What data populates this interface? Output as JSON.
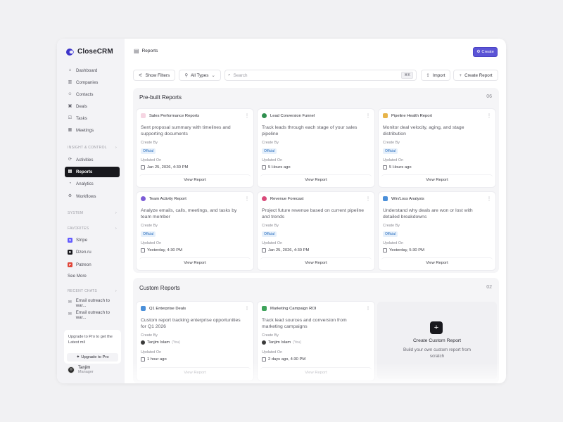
{
  "app": {
    "name": "CloseCRM"
  },
  "sidebar": {
    "main_items": [
      {
        "label": "Dashboard",
        "icon": "home-icon"
      },
      {
        "label": "Companies",
        "icon": "building-icon"
      },
      {
        "label": "Contacts",
        "icon": "users-icon"
      },
      {
        "label": "Deals",
        "icon": "briefcase-icon"
      },
      {
        "label": "Tasks",
        "icon": "checklist-icon"
      },
      {
        "label": "Meetings",
        "icon": "calendar-icon"
      }
    ],
    "insight_label": "INSIGHT & CONTROL",
    "insight_items": [
      {
        "label": "Activities",
        "icon": "activity-icon"
      },
      {
        "label": "Reports",
        "icon": "document-icon"
      },
      {
        "label": "Analytics",
        "icon": "chart-icon"
      },
      {
        "label": "Workflows",
        "icon": "workflow-icon"
      }
    ],
    "system_label": "SYSTEM",
    "favorites_label": "FAVORITES",
    "favorites": [
      {
        "label": "Stripe",
        "color": "#635bff",
        "glyph": "S"
      },
      {
        "label": "Dzen.ru",
        "color": "#18181d",
        "glyph": "D"
      },
      {
        "label": "Patreon",
        "color": "#e0463a",
        "glyph": "P"
      }
    ],
    "see_more": "See More",
    "recent_label": "RECENT CHATS",
    "recent_chats": [
      {
        "label": "Email outreach to war..."
      },
      {
        "label": "Email outreach to war..."
      }
    ],
    "upgrade": {
      "text": "Upgrade to Pro to get the Latest mil",
      "button": "Upgrade to Pro"
    },
    "user": {
      "name": "Tanjim",
      "role": "Manager"
    }
  },
  "header": {
    "breadcrumb": "Reports",
    "create_button": "Create"
  },
  "toolbar": {
    "show_filters": "Show Filters",
    "all_types": "All Types",
    "search_placeholder": "Search",
    "search_shortcut": "⌘K",
    "import": "Import",
    "create_report": "Create Report"
  },
  "prebuilt": {
    "title": "Pre-built Reports",
    "count": "06",
    "cards": [
      {
        "title": "Sales Performance Reports",
        "icon_color": "#f6d5e2",
        "description": "Sent proposal summary with timelines and supporting documents",
        "created_label": "Create By",
        "badge": "Official",
        "updated_label": "Updated On",
        "updated": "Jan 25, 2026, 4:30 PM",
        "button": "View Report"
      },
      {
        "title": "Lead Conversion Funnel",
        "icon_color": "#2f8f4e",
        "description": "Track leads through each stage of your sales pipeline",
        "created_label": "Create By",
        "badge": "Official",
        "updated_label": "Updated On",
        "updated": "5 Hours ago",
        "button": "View Report"
      },
      {
        "title": "Pipeline Health Report",
        "icon_color": "#e7b44a",
        "description": "Monitor deal velocity, aging, and stage distribution",
        "created_label": "Create By",
        "badge": "Official",
        "updated_label": "Updated On",
        "updated": "5 Hours ago",
        "button": "View Report"
      },
      {
        "title": "Team Activity Report",
        "icon_color": "#7c5cd6",
        "description": "Analyze emails, calls, meetings, and tasks by team member",
        "created_label": "Create By",
        "badge": "Official",
        "updated_label": "Updated On",
        "updated": "Yesterday, 4:30 PM",
        "button": "View Report"
      },
      {
        "title": "Revenue Forecast",
        "icon_color": "#d94a7a",
        "description": "Project future revenue based on current pipeline and trends",
        "created_label": "Create By",
        "badge": "Official",
        "updated_label": "Updated On",
        "updated": "Jan 25, 2026, 4:30 PM",
        "button": "View Report"
      },
      {
        "title": "Win/Loss Analysis",
        "icon_color": "#4a8fd9",
        "description": "Understand why deals are won or lost with detailed breakdowns",
        "created_label": "Create By",
        "badge": "Official",
        "updated_label": "Updated On",
        "updated": "Yesterday, 5:30 PM",
        "button": "View Report"
      }
    ]
  },
  "custom": {
    "title": "Custom Reports",
    "count": "02",
    "cards": [
      {
        "title": "Q1 Enterprise Deals",
        "icon_color": "#4a8fd9",
        "description": "Custom report tracking enterprise opportunities for Q1 2026",
        "created_label": "Create By",
        "creator": "Tanjim Islam",
        "creator_tag": "(You)",
        "updated_label": "Updated On",
        "updated": "1 hour ago",
        "button": "View Report"
      },
      {
        "title": "Marketing Campaign ROI",
        "icon_color": "#3fa35b",
        "description": "Track lead sources and conversion from marketing campaigns",
        "created_label": "Create By",
        "creator": "Tanjim Islam",
        "creator_tag": "(You)",
        "updated_label": "Updated On",
        "updated": "2 days ago, 4:30 PM",
        "button": "View Report"
      }
    ],
    "create_card": {
      "title": "Create Custom Report",
      "description": "Build your own custom report from scratch"
    }
  }
}
